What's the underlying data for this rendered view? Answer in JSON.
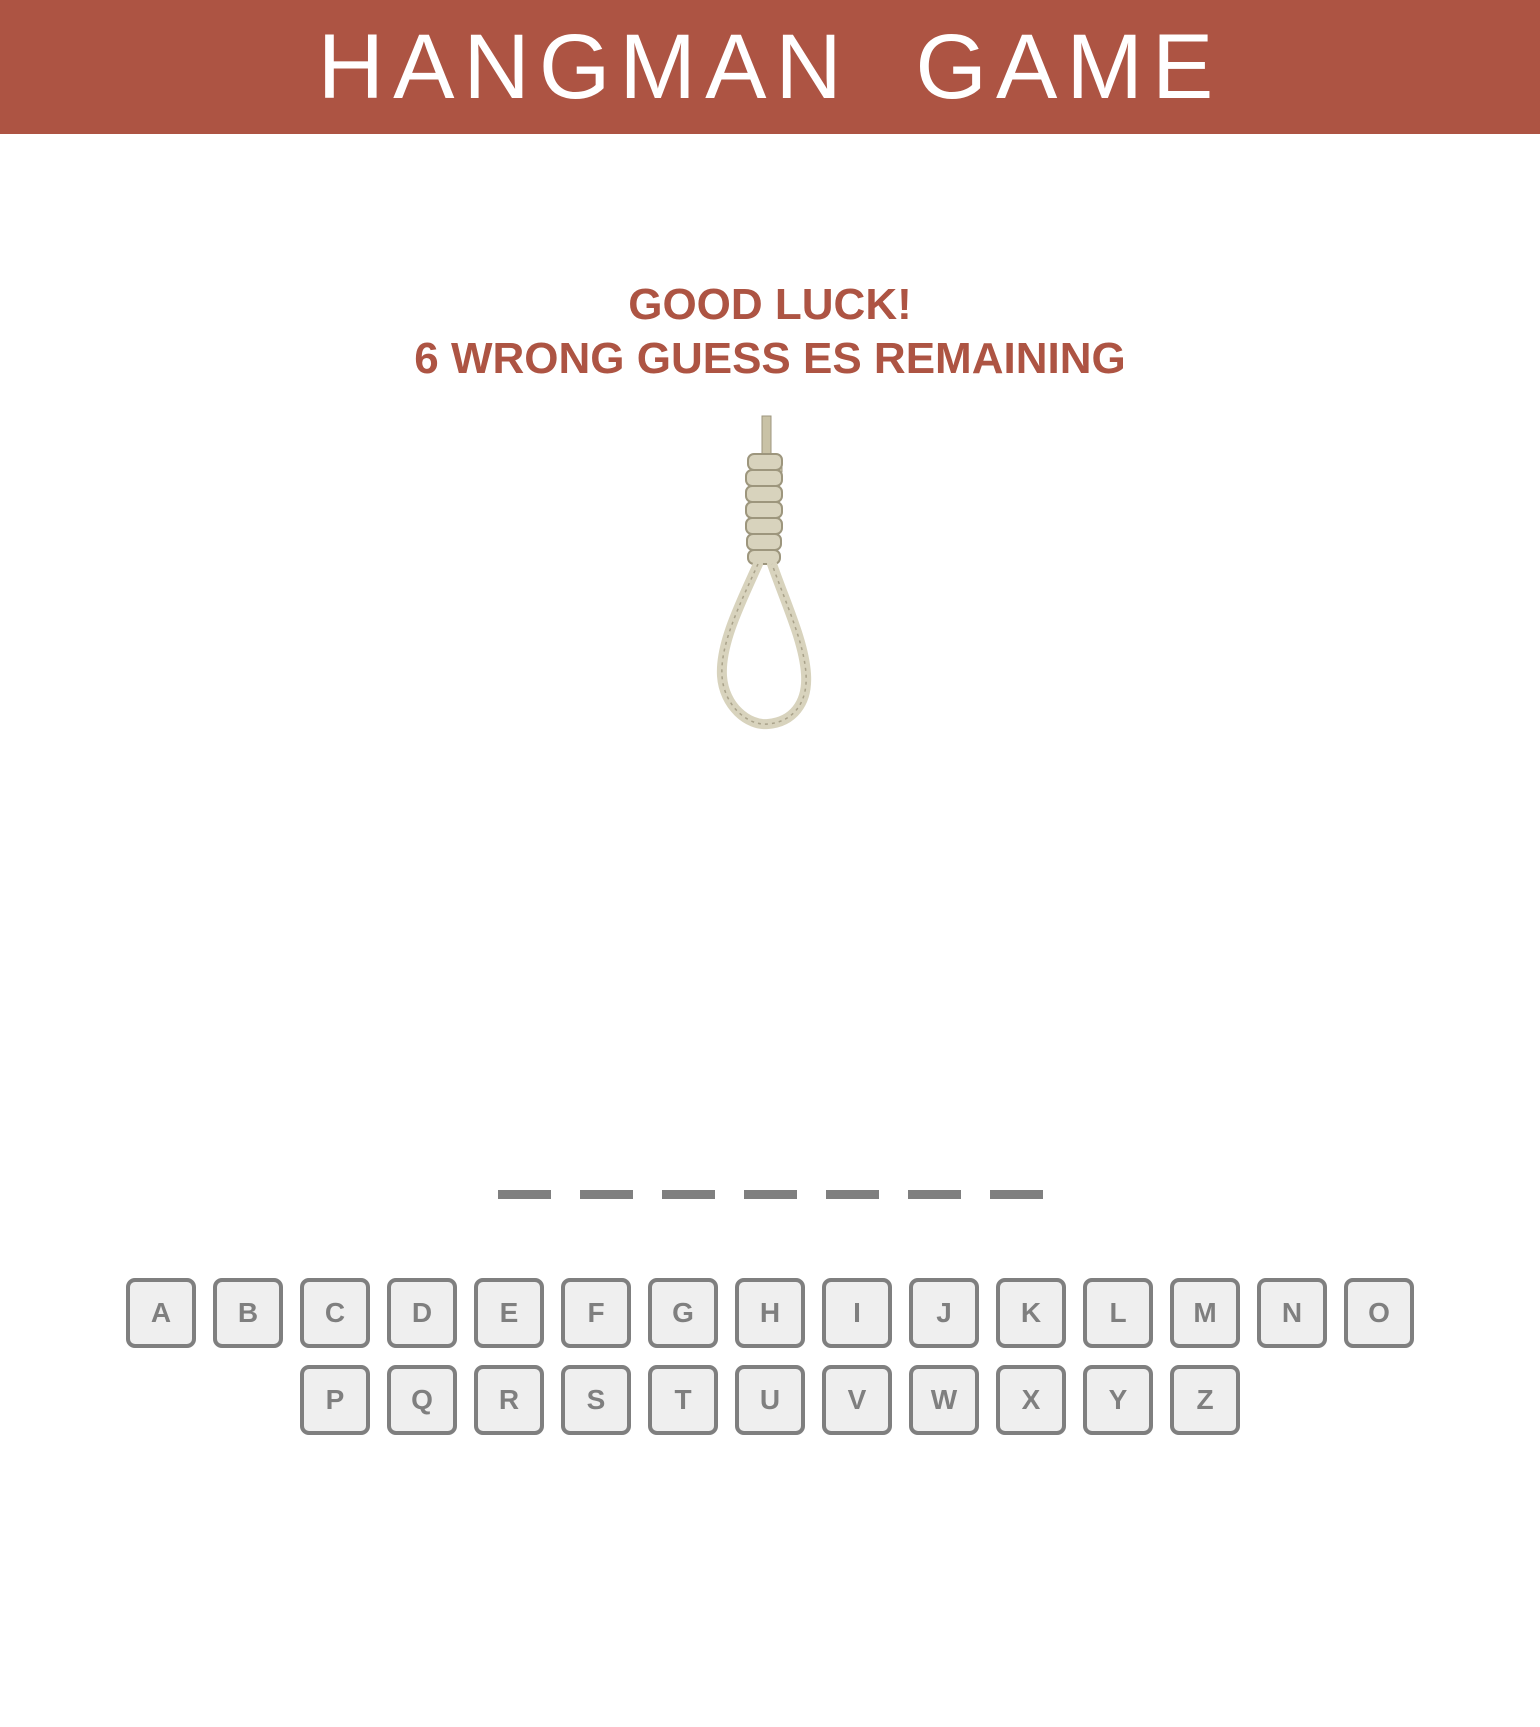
{
  "header": {
    "title": "HANGMAN GAME"
  },
  "status": {
    "line1": "GOOD LUCK!",
    "line2": "6 WRONG GUESS ES REMAINING"
  },
  "illustration": {
    "icon": "noose-icon"
  },
  "word": {
    "letters": [
      "",
      "",
      "",
      "",
      "",
      "",
      ""
    ]
  },
  "keyboard": {
    "row1": [
      "A",
      "B",
      "C",
      "D",
      "E",
      "F",
      "G",
      "H",
      "I",
      "J",
      "K",
      "L",
      "M",
      "N",
      "O"
    ],
    "row2": [
      "P",
      "Q",
      "R",
      "S",
      "T",
      "U",
      "V",
      "W",
      "X",
      "Y",
      "Z"
    ]
  },
  "colors": {
    "accent": "#ad5443",
    "key_border": "#7f7f7f",
    "key_fill": "#efefef",
    "rope": "#d8d3bd"
  }
}
